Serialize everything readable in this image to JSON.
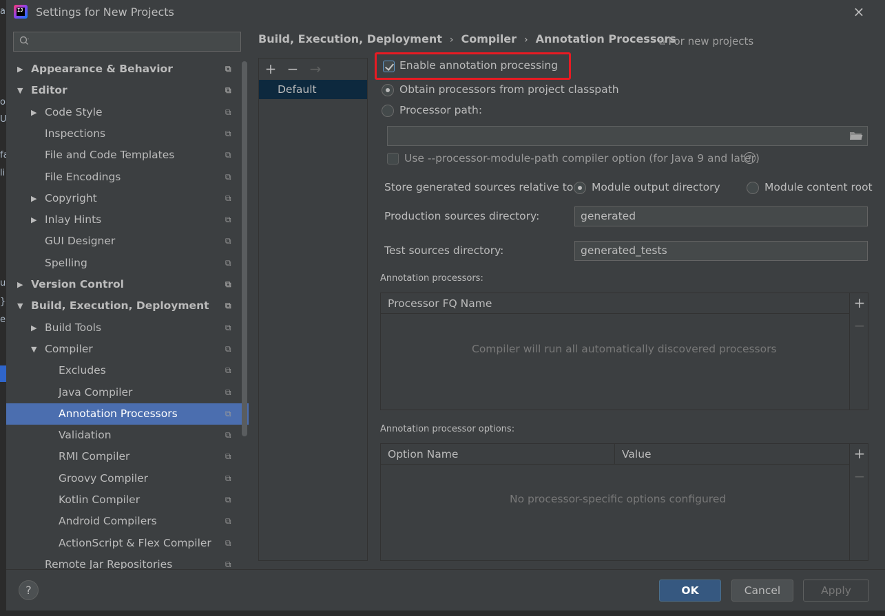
{
  "window": {
    "title": "Settings for New Projects",
    "close_glyph": "×"
  },
  "background_fragments": [
    "an",
    "o",
    "Ut",
    "fa",
    "li",
    "ur",
    "}-\\",
    "e"
  ],
  "search": {
    "placeholder": "",
    "icon": "search-icon"
  },
  "tree": [
    {
      "label": "Appearance & Behavior",
      "level": 0,
      "bold": true,
      "expander": "collapsed"
    },
    {
      "label": "Editor",
      "level": 0,
      "bold": true,
      "expander": "expanded"
    },
    {
      "label": "Code Style",
      "level": 1,
      "expander": "collapsed"
    },
    {
      "label": "Inspections",
      "level": 1
    },
    {
      "label": "File and Code Templates",
      "level": 1
    },
    {
      "label": "File Encodings",
      "level": 1
    },
    {
      "label": "Copyright",
      "level": 1,
      "expander": "collapsed"
    },
    {
      "label": "Inlay Hints",
      "level": 1,
      "expander": "collapsed"
    },
    {
      "label": "GUI Designer",
      "level": 1
    },
    {
      "label": "Spelling",
      "level": 1
    },
    {
      "label": "Version Control",
      "level": 0,
      "bold": true,
      "expander": "collapsed"
    },
    {
      "label": "Build, Execution, Deployment",
      "level": 0,
      "bold": true,
      "expander": "expanded"
    },
    {
      "label": "Build Tools",
      "level": 1,
      "expander": "collapsed"
    },
    {
      "label": "Compiler",
      "level": 1,
      "expander": "expanded"
    },
    {
      "label": "Excludes",
      "level": 2
    },
    {
      "label": "Java Compiler",
      "level": 2
    },
    {
      "label": "Annotation Processors",
      "level": 2,
      "selected": true
    },
    {
      "label": "Validation",
      "level": 2
    },
    {
      "label": "RMI Compiler",
      "level": 2
    },
    {
      "label": "Groovy Compiler",
      "level": 2
    },
    {
      "label": "Kotlin Compiler",
      "level": 2
    },
    {
      "label": "Android Compilers",
      "level": 2
    },
    {
      "label": "ActionScript & Flex Compiler",
      "level": 2
    },
    {
      "label": "Remote Jar Repositories",
      "level": 1
    }
  ],
  "breadcrumb": [
    "Build, Execution, Deployment",
    "Compiler",
    "Annotation Processors"
  ],
  "breadcrumb_separator": "›",
  "scope_label": "For new projects",
  "profiles": {
    "toolbar": [
      "+",
      "−",
      "→"
    ],
    "items": [
      "Default"
    ]
  },
  "main": {
    "enable_annotation_processing": {
      "label": "Enable annotation processing",
      "checked": true
    },
    "obtain_from_classpath": {
      "label": "Obtain processors from project classpath",
      "selected": true
    },
    "processor_path": {
      "label": "Processor path:",
      "value": ""
    },
    "module_path_option": {
      "label": "Use --processor-module-path compiler option (for Java 9 and later)",
      "checked": false
    },
    "help_glyph": "?",
    "store_generated": {
      "label": "Store generated sources relative to:",
      "options": [
        {
          "label": "Module output directory",
          "selected": true
        },
        {
          "label": "Module content root",
          "selected": false
        }
      ]
    },
    "production_dir": {
      "label": "Production sources directory:",
      "value": "generated"
    },
    "test_dir": {
      "label": "Test sources directory:",
      "value": "generated_tests"
    },
    "processors_section": {
      "title": "Annotation processors:",
      "columns": [
        "Processor FQ Name"
      ],
      "empty": "Compiler will run all automatically discovered processors",
      "add": "+",
      "remove": "−"
    },
    "options_section": {
      "title": "Annotation processor options:",
      "columns": [
        "Option Name",
        "Value"
      ],
      "empty": "No processor-specific options configured",
      "add": "+",
      "remove": "−"
    }
  },
  "footer": {
    "help": "?",
    "ok": "OK",
    "cancel": "Cancel",
    "apply": "Apply"
  },
  "colors": {
    "accent_selection": "#4b6eaf",
    "highlight_box": "#e81b23",
    "ok_button": "#365880"
  }
}
